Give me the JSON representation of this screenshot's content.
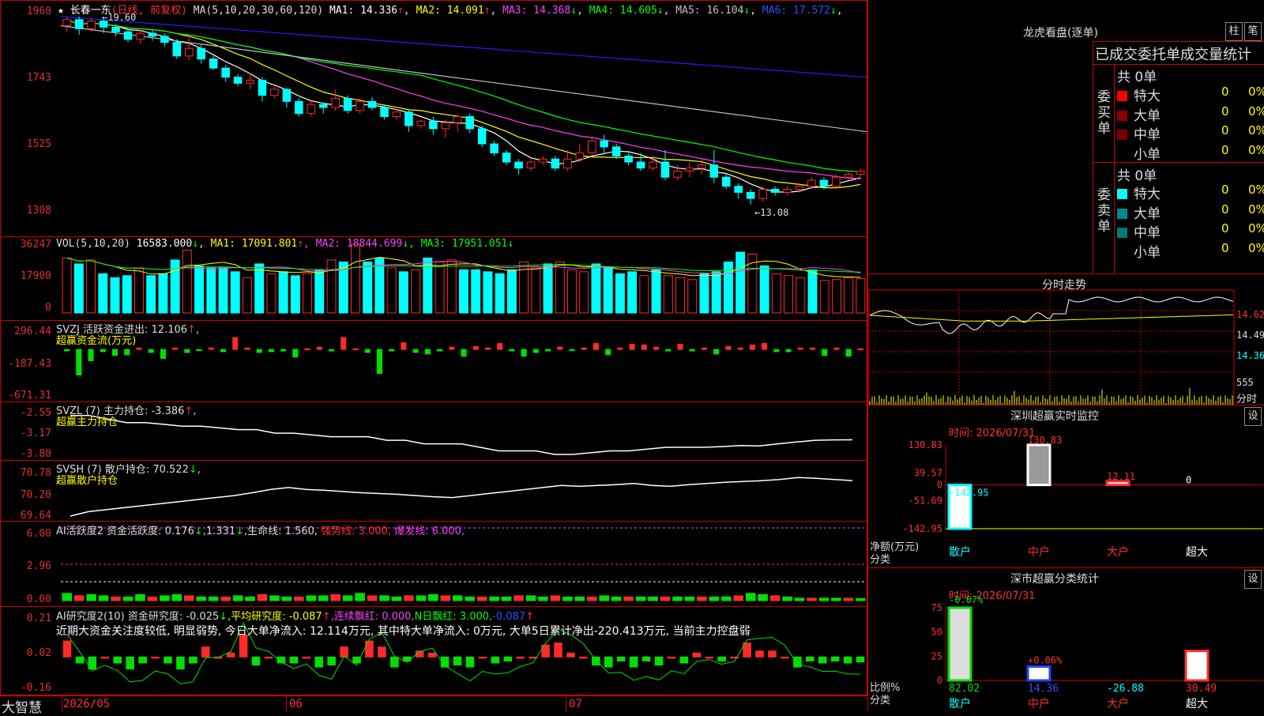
{
  "colors": {
    "up": "#ff2a2a",
    "down": "#00ffff",
    "ma1": "#ffffff",
    "ma2": "#ffff00",
    "ma3": "#ff40ff",
    "ma4": "#00ff00",
    "ma5": "#c0c0c0",
    "ma6": "#2020ff"
  },
  "main": {
    "title": "★ 长春一东",
    "period": "(日线, 前复权)",
    "ma_param": "MA(5,10,20,30,60,120)",
    "ma_values": [
      {
        "label": "MA1: 14.336",
        "arrow": "↑",
        "color": "#ffffff",
        "arrow_color": "#ff3030"
      },
      {
        "label": "MA2: 14.091",
        "arrow": "↑",
        "color": "#ffff00",
        "arrow_color": "#ff3030"
      },
      {
        "label": "MA3: 14.368",
        "arrow": "↓",
        "color": "#ff40ff",
        "arrow_color": "#00ff00"
      },
      {
        "label": "MA4: 14.605",
        "arrow": "↓",
        "color": "#00ff00",
        "arrow_color": "#00ff00"
      },
      {
        "label": "MA5: 16.104",
        "arrow": "↓",
        "color": "#c0c0c0",
        "arrow_color": "#00ff00"
      },
      {
        "label": "MA6: 17.572",
        "arrow": "↓",
        "color": "#3050ff",
        "arrow_color": "#00ff00"
      }
    ],
    "y_labels": [
      "1960",
      "1743",
      "1525",
      "1308"
    ],
    "high_note": "19.60",
    "low_note": "13.08"
  },
  "vol": {
    "header": "VOL(5,10,20)",
    "vol_value": "16583.000",
    "vol_arrow": "↓",
    "ma": [
      {
        "label": "MA1: 17091.801",
        "arrow": "↑",
        "color": "#ffff00",
        "arrow_color": "#ff3030"
      },
      {
        "label": "MA2: 18844.699",
        "arrow": "↓",
        "color": "#ff40ff",
        "arrow_color": "#00ff00"
      },
      {
        "label": "MA3: 17951.051",
        "arrow": "↓",
        "color": "#00ff00",
        "arrow_color": "#00ff00"
      }
    ],
    "y_labels": [
      "36247",
      "17900",
      "0"
    ]
  },
  "svzj": {
    "header": "SVZJ  活跃资金进出: 12.106",
    "arrow": "↑",
    "sub": "超赢资金流(万元)",
    "y_labels": [
      "296.44",
      "-187.43",
      "-671.31"
    ]
  },
  "svzl": {
    "header": "SVZL (7) 主力持仓: -3.386",
    "arrow": "↑",
    "tail": ",",
    "sub": "超赢主力持仓",
    "y_labels": [
      "-2.55",
      "-3.17",
      "-3.80"
    ]
  },
  "svsh": {
    "header": "SVSH (7) 散户持仓: 70.522",
    "arrow": "↓",
    "tail": ",",
    "sub": "超赢散户持仓",
    "y_labels": [
      "70.78",
      "70.20",
      "69.64"
    ]
  },
  "ai1": {
    "header": "AI活跃度2 资金活跃度: 0.176",
    "arrow1": "↓",
    "v2": ",1.331",
    "arrow2": "↓",
    "life": ",生命线: 1.560,",
    "strong": "强势线: 3.000,",
    "burst": "爆发线: 6.000,",
    "y_labels": [
      "6.00",
      "2.96",
      "0.00"
    ]
  },
  "ai2": {
    "header": "AI研究度2(10) 资金研究度: -0.025",
    "a1": "↓",
    "avg": ",平均研究度: -0.087",
    "a2": "↑",
    "lian": ",连续飘红: 0.000,",
    "nri": "N日飘红: 3.000,",
    "last": "-0.087",
    "a3": "↑",
    "comment": "近期大资金关注度较低, 明显弱势, 今日大单净流入: 12.114万元, 其中特大单净流入: 0万元, 大单5日累计净出-220.413万元, 当前主力控盘弱",
    "y_labels": [
      "0.21",
      "0.02",
      "-0.16"
    ]
  },
  "xaxis": {
    "app": "大智慧",
    "dates": [
      "2026/05",
      "06",
      "07"
    ]
  },
  "right": {
    "lhb_title": "龙虎看盘(逐单)",
    "btn_zhu": "柱",
    "btn_bi": "笔",
    "stat_title": "已成交委托单成交量统计",
    "buy_label": "委买单",
    "sell_label": "委卖单",
    "buy_total": "共 0单",
    "sell_total": "共 0单",
    "buy_rows": [
      {
        "name": "特大",
        "v": "0",
        "p": "0%",
        "c": "#ff0000"
      },
      {
        "name": "大单",
        "v": "0",
        "p": "0%",
        "c": "#8b0000"
      },
      {
        "name": "中单",
        "v": "0",
        "p": "0%",
        "c": "#7a0000"
      },
      {
        "name": "小单",
        "v": "0",
        "p": "0%",
        "c": ""
      }
    ],
    "sell_rows": [
      {
        "name": "特大",
        "v": "0",
        "p": "0%",
        "c": "#00ffff"
      },
      {
        "name": "大单",
        "v": "0",
        "p": "0%",
        "c": "#008b8b"
      },
      {
        "name": "中单",
        "v": "0",
        "p": "0%",
        "c": "#007a7a"
      },
      {
        "name": "小单",
        "v": "0",
        "p": "0%",
        "c": ""
      }
    ],
    "fs_title": "分时走势",
    "fs_y": [
      "14.62",
      "14.49",
      "14.36",
      "555",
      "分时"
    ],
    "sz_title": "深圳超赢实时监控",
    "sz_btn": "设",
    "sz_time": "时间: 2026/07/31",
    "sz_y": [
      "130.83",
      "39.57",
      "0",
      "-51.69",
      "-142.95"
    ],
    "sz_unit": "净额(万元)",
    "sz_cat": "分类",
    "sz_bar_labels": [
      "-142.95",
      "130.83",
      "12.11",
      "0"
    ],
    "sz_cats": [
      "散户",
      "中户",
      "大户",
      "超大"
    ],
    "ss_title": "深市超赢分类统计",
    "ss_btn": "设",
    "ss_time": "时间: 2026/07/31",
    "ss_y": [
      "75",
      "50",
      "25",
      "0"
    ],
    "ss_top_labels": [
      "-0.07%",
      "+0.06%"
    ],
    "ss_unit": "比例%",
    "ss_cat": "分类",
    "ss_vals": [
      "82.02",
      "14.36",
      "-26.88",
      "30.49"
    ],
    "ss_cats": [
      "散户",
      "中户",
      "大户",
      "超大"
    ]
  },
  "chart_data": [
    {
      "type": "candlestick",
      "title": "长春一东",
      "period": "日线, 前复权",
      "ylim": [
        13.08,
        19.6
      ],
      "candles": [
        [
          19.3,
          19.5,
          19.1,
          19.6
        ],
        [
          19.5,
          19.2,
          19.0,
          19.6
        ],
        [
          19.2,
          19.45,
          19.1,
          19.55
        ],
        [
          19.45,
          19.25,
          19.05,
          19.5
        ],
        [
          19.25,
          19.1,
          18.95,
          19.35
        ],
        [
          19.1,
          18.85,
          18.75,
          19.2
        ],
        [
          18.85,
          19.05,
          18.7,
          19.15
        ],
        [
          19.05,
          18.95,
          18.8,
          19.15
        ],
        [
          18.95,
          18.75,
          18.6,
          19.05
        ],
        [
          18.75,
          18.3,
          18.2,
          18.85
        ],
        [
          18.3,
          18.55,
          18.15,
          18.9
        ],
        [
          18.55,
          18.2,
          18.05,
          18.7
        ],
        [
          18.2,
          17.9,
          17.85,
          18.3
        ],
        [
          17.9,
          17.6,
          17.45,
          18.0
        ],
        [
          17.6,
          17.4,
          17.3,
          17.7
        ],
        [
          17.4,
          17.5,
          17.2,
          17.75
        ],
        [
          17.5,
          17.0,
          16.8,
          17.6
        ],
        [
          17.0,
          17.2,
          16.9,
          17.3
        ],
        [
          17.2,
          16.8,
          16.6,
          17.25
        ],
        [
          16.8,
          16.4,
          16.3,
          16.9
        ],
        [
          16.4,
          16.7,
          16.3,
          16.8
        ],
        [
          16.7,
          16.6,
          16.4,
          16.75
        ],
        [
          16.6,
          16.9,
          16.5,
          17.2
        ],
        [
          16.9,
          16.5,
          16.4,
          17.0
        ],
        [
          16.5,
          16.8,
          16.4,
          16.9
        ],
        [
          16.8,
          16.6,
          16.5,
          16.95
        ],
        [
          16.6,
          16.3,
          16.2,
          16.7
        ],
        [
          16.3,
          16.45,
          16.2,
          16.55
        ],
        [
          16.45,
          16.0,
          15.8,
          16.5
        ],
        [
          16.0,
          16.15,
          15.9,
          16.2
        ],
        [
          16.15,
          15.9,
          15.7,
          16.3
        ],
        [
          15.9,
          16.1,
          15.6,
          16.2
        ],
        [
          16.1,
          16.3,
          15.8,
          16.4
        ],
        [
          16.3,
          15.9,
          15.75,
          16.4
        ],
        [
          15.9,
          15.4,
          15.3,
          16.0
        ],
        [
          15.4,
          15.1,
          15.0,
          15.5
        ],
        [
          15.1,
          14.8,
          14.7,
          15.2
        ],
        [
          14.8,
          14.6,
          14.4,
          14.9
        ],
        [
          14.6,
          14.8,
          14.5,
          14.9
        ],
        [
          14.8,
          14.9,
          14.7,
          15.0
        ],
        [
          14.9,
          14.6,
          14.5,
          15.0
        ],
        [
          14.6,
          14.9,
          14.5,
          15.2
        ],
        [
          14.9,
          15.1,
          14.8,
          15.4
        ],
        [
          15.1,
          15.5,
          15.0,
          15.6
        ],
        [
          15.5,
          15.3,
          15.1,
          15.7
        ],
        [
          15.3,
          15.0,
          14.9,
          15.4
        ],
        [
          15.0,
          14.8,
          14.7,
          15.1
        ],
        [
          14.8,
          14.6,
          14.5,
          15.1
        ],
        [
          14.6,
          14.8,
          14.5,
          15.0
        ],
        [
          14.8,
          14.3,
          14.2,
          15.2
        ],
        [
          14.3,
          14.5,
          14.2,
          14.7
        ],
        [
          14.5,
          14.6,
          14.3,
          14.8
        ],
        [
          14.6,
          14.7,
          14.4,
          14.9
        ],
        [
          14.7,
          14.3,
          14.1,
          15.2
        ],
        [
          14.3,
          14.0,
          13.9,
          14.4
        ],
        [
          14.0,
          13.8,
          13.6,
          14.1
        ],
        [
          13.8,
          13.6,
          13.4,
          13.9
        ],
        [
          13.6,
          13.9,
          13.5,
          14.0
        ],
        [
          13.9,
          13.8,
          13.7,
          14.0
        ],
        [
          13.8,
          13.9,
          13.7,
          14.0
        ],
        [
          13.9,
          14.0,
          13.8,
          14.1
        ],
        [
          14.0,
          14.2,
          13.9,
          14.3
        ],
        [
          14.2,
          14.0,
          13.9,
          14.3
        ],
        [
          14.0,
          14.3,
          13.9,
          14.4
        ],
        [
          14.3,
          14.4,
          14.2,
          14.5
        ],
        [
          14.4,
          14.5,
          14.3,
          14.6
        ]
      ]
    },
    {
      "type": "bar",
      "title": "VOL",
      "ylim": [
        0,
        36247
      ],
      "values": [
        28000,
        25000,
        27000,
        20000,
        18000,
        19000,
        23000,
        19000,
        20000,
        27000,
        32000,
        24000,
        23000,
        23000,
        21000,
        18000,
        25000,
        20000,
        21000,
        19000,
        20000,
        22000,
        27000,
        26000,
        35000,
        26000,
        28000,
        23000,
        21000,
        22000,
        28000,
        26000,
        27000,
        22000,
        22000,
        21000,
        20000,
        22000,
        26000,
        23000,
        25000,
        26000,
        22000,
        21000,
        25000,
        23000,
        20000,
        21000,
        19000,
        22000,
        19000,
        18000,
        17000,
        20000,
        21000,
        26000,
        31000,
        30000,
        24000,
        20000,
        19000,
        18000,
        22000,
        16583,
        17000,
        18000,
        17500
      ]
    },
    {
      "type": "bar",
      "title": "SVZJ 活跃资金进出",
      "ylim": [
        -671.31,
        296.44
      ],
      "values": [
        -20,
        -340,
        -150,
        -30,
        -80,
        -70,
        20,
        -40,
        -120,
        20,
        -40,
        -10,
        20,
        -30,
        160,
        20,
        -40,
        -30,
        -20,
        -100,
        10,
        30,
        -20,
        160,
        10,
        -40,
        -320,
        -20,
        90,
        -40,
        -60,
        -20,
        30,
        -90,
        40,
        20,
        80,
        -20,
        -90,
        -40,
        -20,
        30,
        -10,
        20,
        80,
        -70,
        20,
        70,
        60,
        30,
        -20,
        70,
        -20,
        20,
        -60,
        40,
        20,
        60,
        80,
        -30,
        -30,
        20,
        20,
        -80,
        20,
        -90,
        10
      ]
    },
    {
      "type": "line",
      "title": "SVZL 主力持仓",
      "ylim": [
        -3.8,
        -2.55
      ],
      "values": [
        -2.7,
        -2.7,
        -2.8,
        -2.9,
        -2.9,
        -2.95,
        -3.0,
        -3.0,
        -3.05,
        -3.1,
        -3.1,
        -3.2,
        -3.2,
        -3.25,
        -3.3,
        -3.3,
        -3.3,
        -3.4,
        -3.4,
        -3.5,
        -3.5,
        -3.5,
        -3.6,
        -3.7,
        -3.7,
        -3.7,
        -3.8,
        -3.8,
        -3.75,
        -3.7,
        -3.7,
        -3.65,
        -3.6,
        -3.6,
        -3.6,
        -3.58,
        -3.55,
        -3.56,
        -3.5,
        -3.45,
        -3.4,
        -3.39,
        -3.386
      ]
    },
    {
      "type": "line",
      "title": "SVSH 散户持仓",
      "ylim": [
        69.64,
        70.78
      ],
      "values": [
        69.64,
        69.75,
        69.8,
        69.85,
        69.9,
        69.95,
        70.0,
        70.05,
        70.1,
        70.15,
        70.22,
        70.3,
        70.35,
        70.3,
        70.28,
        70.25,
        70.22,
        70.2,
        70.18,
        70.15,
        70.12,
        70.1,
        70.15,
        70.2,
        70.25,
        70.3,
        70.35,
        70.4,
        70.38,
        70.4,
        70.42,
        70.45,
        70.4,
        70.38,
        70.42,
        70.45,
        70.48,
        70.5,
        70.52,
        70.55,
        70.6,
        70.58,
        70.55,
        70.522
      ]
    },
    {
      "type": "bar",
      "title": "AI活跃度2",
      "ylim": [
        0,
        6.0
      ],
      "values": [
        0.6,
        0.4,
        0.5,
        0.4,
        0.3,
        0.3,
        0.5,
        0.3,
        0.4,
        0.5,
        0.4,
        0.3,
        0.3,
        0.3,
        0.4,
        0.3,
        0.5,
        0.4,
        0.3,
        0.3,
        0.4,
        0.4,
        0.5,
        0.4,
        0.6,
        0.4,
        0.4,
        0.3,
        0.4,
        0.4,
        0.5,
        0.4,
        0.4,
        0.3,
        0.3,
        0.3,
        0.3,
        0.4,
        0.4,
        0.3,
        0.4,
        0.3,
        0.3,
        0.3,
        0.4,
        0.3,
        0.3,
        0.3,
        0.3,
        0.3,
        0.3,
        0.3,
        0.3,
        0.3,
        0.3,
        0.4,
        0.6,
        0.5,
        0.4,
        0.3,
        0.2,
        0.2,
        0.2,
        0.2,
        0.2,
        0.176
      ]
    },
    {
      "type": "bar",
      "title": "AI研究度2(10)",
      "ylim": [
        -0.16,
        0.21
      ],
      "values": [
        0.08,
        -0.03,
        -0.06,
        0.0,
        -0.03,
        -0.06,
        -0.03,
        0.0,
        -0.03,
        -0.06,
        -0.03,
        0.05,
        0.0,
        0.02,
        0.11,
        -0.04,
        0.0,
        -0.03,
        -0.03,
        0.0,
        -0.05,
        -0.04,
        0.05,
        -0.03,
        0.08,
        0.05,
        -0.05,
        -0.02,
        0.03,
        0.02,
        -0.05,
        -0.04,
        -0.05,
        0.0,
        -0.03,
        -0.02,
        0.0,
        0.0,
        0.06,
        0.07,
        0.02,
        0.0,
        -0.04,
        -0.05,
        -0.02,
        -0.05,
        -0.02,
        -0.04,
        0.0,
        -0.03,
        0.02,
        0.0,
        -0.02,
        0.0,
        0.07,
        0.03,
        0.03,
        0.0,
        -0.05,
        -0.02,
        -0.03,
        -0.02,
        -0.03,
        -0.025
      ]
    },
    {
      "type": "bar",
      "title": "深圳超赢实时监控",
      "categories": [
        "散户",
        "中户",
        "大户",
        "超大"
      ],
      "values": [
        -142.95,
        130.83,
        12.11,
        0
      ],
      "ylim": [
        -142.95,
        130.83
      ],
      "ylabel": "净额(万元)"
    },
    {
      "type": "bar",
      "title": "深市超赢分类统计",
      "categories": [
        "散户",
        "中户",
        "大户",
        "超大"
      ],
      "values": [
        82.02,
        14.36,
        -26.88,
        30.49
      ],
      "ylim": [
        0,
        75
      ],
      "ylabel": "比例%"
    }
  ]
}
